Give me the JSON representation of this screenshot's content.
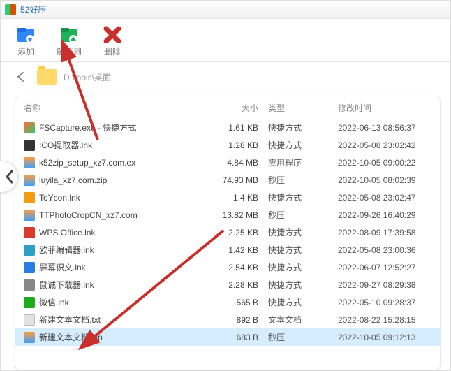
{
  "window": {
    "title": "52好压"
  },
  "toolbar": {
    "add_label": "添加",
    "extract_label": "解压到",
    "delete_label": "删除"
  },
  "nav": {
    "path": "D:\\tools\\桌面"
  },
  "columns": {
    "name": "名称",
    "size": "大小",
    "type": "类型",
    "date": "修改时间"
  },
  "files": [
    {
      "icon": "fscapture",
      "name": "FSCapture.exe - 快捷方式",
      "size": "1.61 KB",
      "type": "快捷方式",
      "date": "2022-06-13 08:56:37"
    },
    {
      "icon": "ico",
      "name": "ICO提取器.lnk",
      "size": "1.28 KB",
      "type": "快捷方式",
      "date": "2022-05-08 23:02:42"
    },
    {
      "icon": "zip",
      "name": "k52zip_setup_xz7.com.ex",
      "size": "4.84 MB",
      "type": "应用程序",
      "date": "2022-10-05 09:00:22"
    },
    {
      "icon": "zip",
      "name": "luyila_xz7.com.zip",
      "size": "74.93 MB",
      "type": "秒压",
      "date": "2022-10-05 08:02:39"
    },
    {
      "icon": "toycon",
      "name": "ToYcon.lnk",
      "size": "1.4 KB",
      "type": "快捷方式",
      "date": "2022-05-08 23:02:47"
    },
    {
      "icon": "zip",
      "name": "TTPhotoCropCN_xz7.com",
      "size": "13.82 MB",
      "type": "秒压",
      "date": "2022-09-26 16:40:29"
    },
    {
      "icon": "wps",
      "name": "WPS Office.lnk",
      "size": "2.25 KB",
      "type": "快捷方式",
      "date": "2022-08-09 17:39:58"
    },
    {
      "icon": "oufei",
      "name": "欧菲编辑器.lnk",
      "size": "1.42 KB",
      "type": "快捷方式",
      "date": "2022-05-08 23:00:36"
    },
    {
      "icon": "screen",
      "name": "屏幕识文.lnk",
      "size": "2.54 KB",
      "type": "快捷方式",
      "date": "2022-06-07 12:52:27"
    },
    {
      "icon": "mouse",
      "name": "鼠诚下载器.lnk",
      "size": "2.28 KB",
      "type": "快捷方式",
      "date": "2022-09-27 08:29:38"
    },
    {
      "icon": "wechat",
      "name": "微信.lnk",
      "size": "565 B",
      "type": "快捷方式",
      "date": "2022-05-10 09:28:37"
    },
    {
      "icon": "txt",
      "name": "新建文本文档.txt",
      "size": "892 B",
      "type": "文本文档",
      "date": "2022-08-22 15:28:15"
    },
    {
      "icon": "zip",
      "name": "新建文本文档.zip",
      "size": "683 B",
      "type": "秒压",
      "date": "2022-10-05 09:12:13",
      "selected": true
    }
  ]
}
